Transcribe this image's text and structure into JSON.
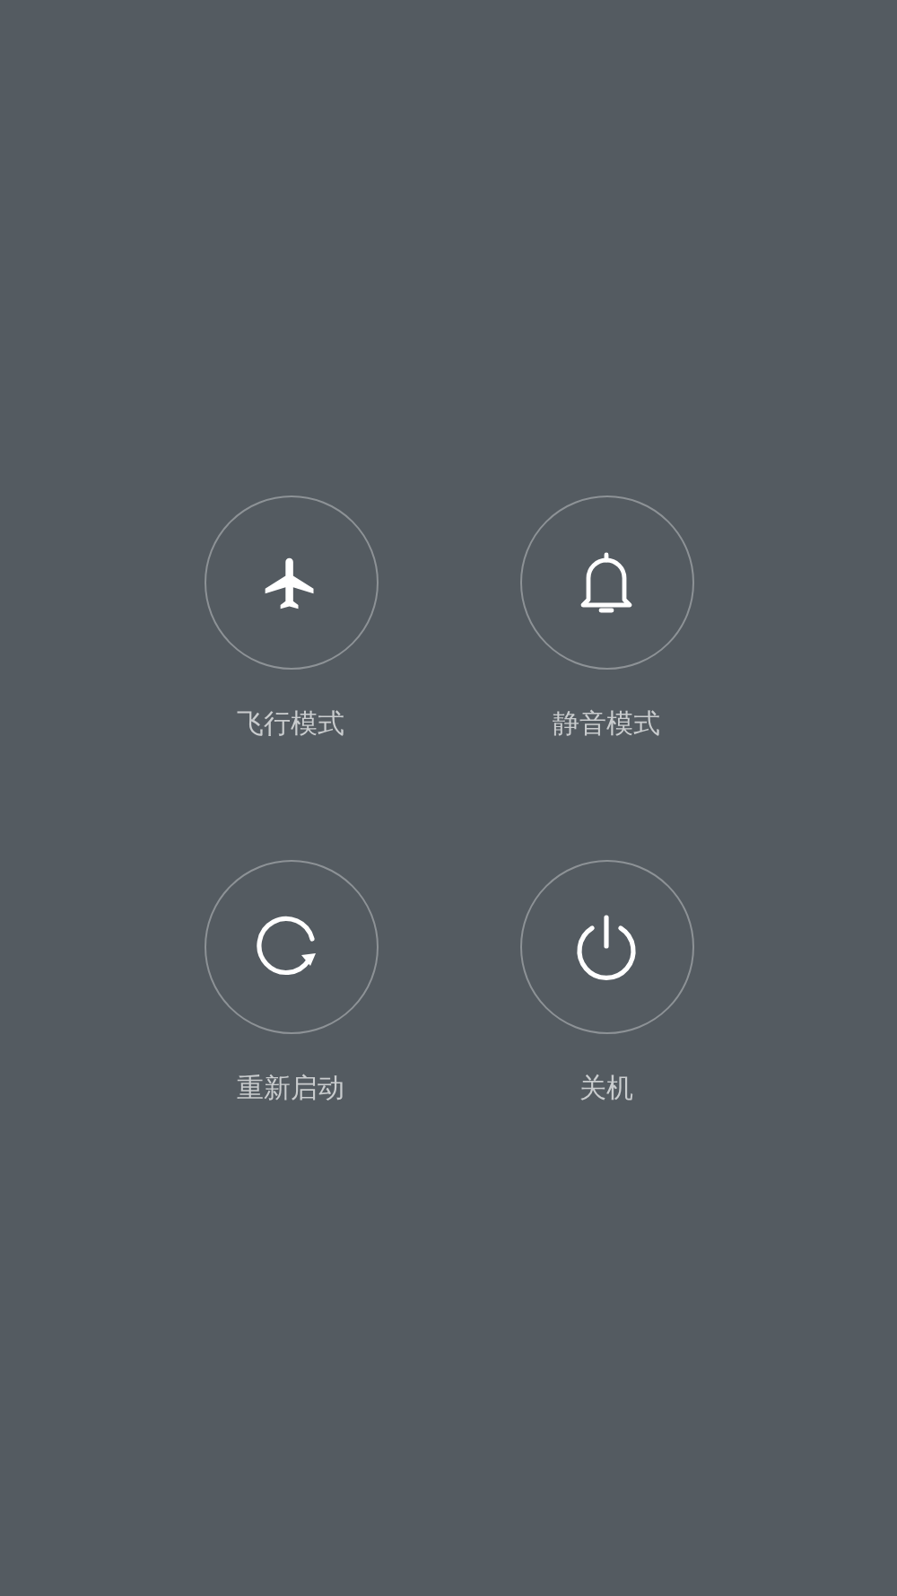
{
  "power_menu": [
    {
      "kind": "airplane",
      "label": "飞行模式"
    },
    {
      "kind": "bell",
      "label": "静音模式"
    },
    {
      "kind": "restart",
      "label": "重新启动"
    },
    {
      "kind": "power",
      "label": "关机"
    }
  ]
}
